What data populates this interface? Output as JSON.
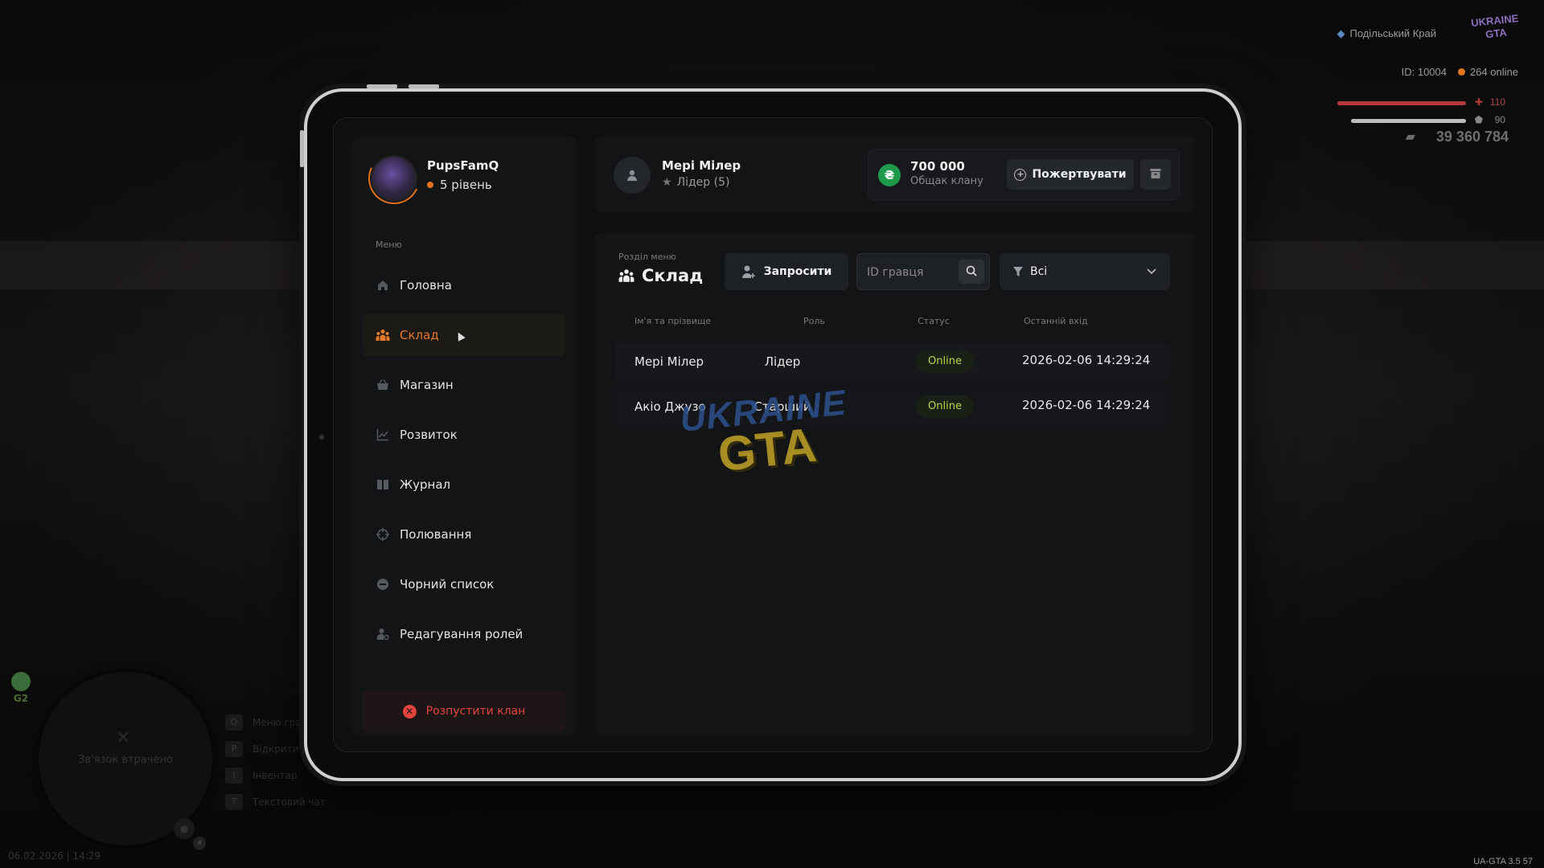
{
  "hud": {
    "server": "Подільський Край",
    "id_text": "ID: 10004",
    "online_text": "264 online",
    "hp": "110",
    "armor": "90",
    "money": "39 360 784",
    "logo_text": "UKRAINE GTA"
  },
  "bottom_hud": {
    "gps_label": "G2",
    "connection_lost": "Зв'язок втрачено",
    "mic_badge": "я",
    "keys": [
      {
        "key": "O",
        "label": "Меню гра"
      },
      {
        "key": "P",
        "label": "Відкрити"
      },
      {
        "key": "I",
        "label": "Інвентар"
      },
      {
        "key": "T",
        "label": "Текстовий чат"
      }
    ],
    "datetime": "06.02.2026 | 14:29",
    "version": "UA-GTA 3.5",
    "corner_num": "57"
  },
  "profile": {
    "name": "PupsFamQ",
    "level": "5 рівень"
  },
  "menu": {
    "title": "Меню",
    "items": [
      {
        "label": "Головна",
        "icon": "home-icon"
      },
      {
        "label": "Склад",
        "icon": "users-icon"
      },
      {
        "label": "Магазин",
        "icon": "basket-icon"
      },
      {
        "label": "Розвиток",
        "icon": "chart-icon"
      },
      {
        "label": "Журнал",
        "icon": "book-icon"
      },
      {
        "label": "Полювання",
        "icon": "crosshair-icon"
      },
      {
        "label": "Чорний список",
        "icon": "block-icon"
      },
      {
        "label": "Редагування ролей",
        "icon": "user-gear-icon"
      }
    ],
    "active_index": 1,
    "disband_label": "Розпустити клан"
  },
  "header": {
    "user_name": "Мері Мілер",
    "user_role": "Лідер (5)",
    "bank_amount": "700 000",
    "bank_label": "Общак клану",
    "donate_label": "Пожертвувати",
    "currency_symbol": "₴"
  },
  "main": {
    "section_label": "Розділ меню",
    "section_title": "Склад",
    "invite_label": "Запросити",
    "search_placeholder": "ID гравця",
    "filter_value": "Всі",
    "columns": [
      "Ім'я та прізвище",
      "Роль",
      "Статус",
      "Останній вхід"
    ],
    "rows": [
      {
        "name": "Мері Мілер",
        "role": "Лідер",
        "status": "Online",
        "last": "2026-02-06 14:29:24"
      },
      {
        "name": "Акіо Джузо",
        "role": "Старший",
        "status": "Online",
        "last": "2026-02-06 14:29:24"
      }
    ],
    "watermark_top": "UKRAINE",
    "watermark_bottom": "GTA"
  },
  "colors": {
    "accent": "#e3782b",
    "online": "#b7d84a",
    "danger": "#e0443c",
    "coin": "#1f9a4c"
  }
}
